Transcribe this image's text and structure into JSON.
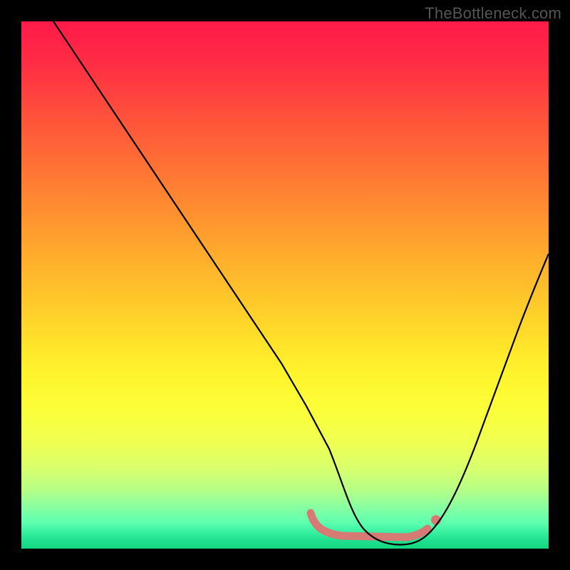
{
  "watermark": "TheBottleneck.com",
  "chart_data": {
    "type": "line",
    "title": "",
    "xlabel": "",
    "ylabel": "",
    "xlim": [
      0,
      100
    ],
    "ylim": [
      0,
      100
    ],
    "grid": false,
    "series": [
      {
        "name": "curve",
        "x": [
          0,
          5,
          10,
          15,
          20,
          25,
          30,
          35,
          40,
          45,
          50,
          55,
          58,
          60,
          63,
          66,
          70,
          75,
          80,
          85,
          90,
          95,
          100
        ],
        "y": [
          100,
          92,
          84,
          76,
          68,
          60,
          52,
          44,
          36,
          28,
          20,
          12,
          7,
          4,
          2,
          1,
          1,
          2,
          6,
          14,
          26,
          40,
          56
        ]
      }
    ],
    "highlight": {
      "name": "flat-bottom",
      "x_range": [
        56,
        80
      ],
      "y": 2
    }
  },
  "colors": {
    "gradient_top": "#ff1a4a",
    "gradient_mid": "#fff22b",
    "gradient_bottom": "#14d680",
    "curve": "#000000",
    "flourish": "#d77a76",
    "frame": "#000000"
  }
}
